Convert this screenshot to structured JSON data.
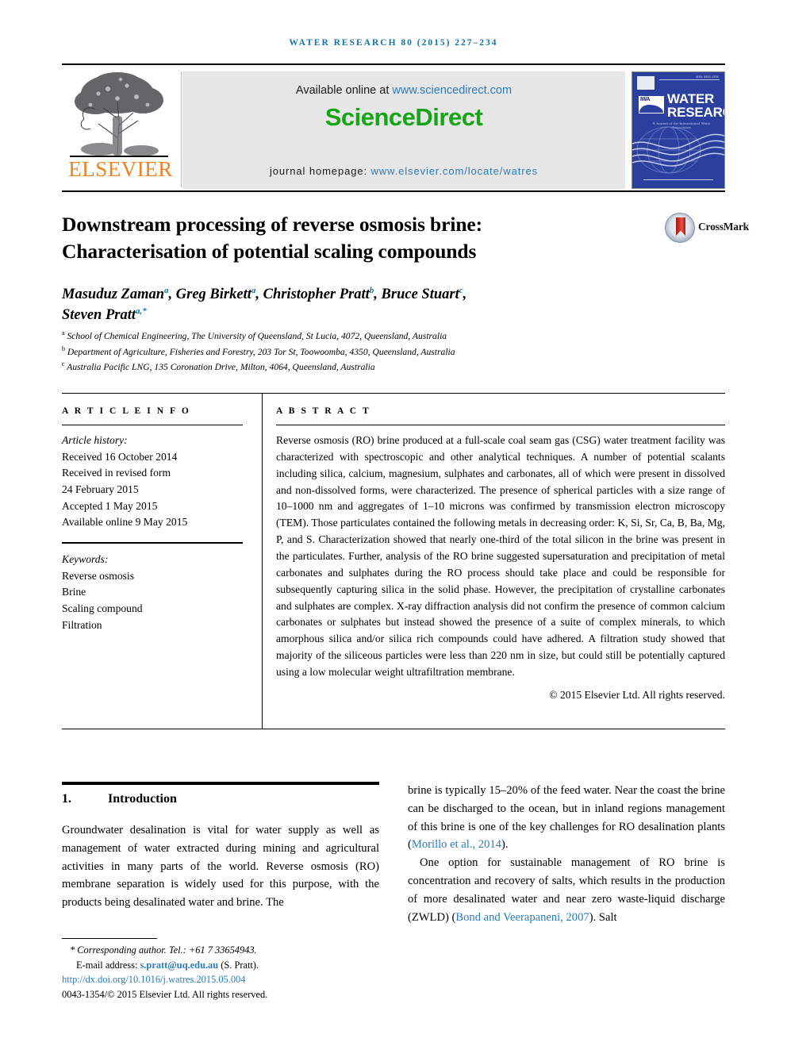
{
  "running_head": "WATER RESEARCH 80 (2015) 227–234",
  "masthead": {
    "publisher_name": "ELSEVIER",
    "available_prefix": "Available online at ",
    "available_url": "www.sciencedirect.com",
    "sciencedirect_logo": "ScienceDirect",
    "homepage_prefix": "journal homepage: ",
    "homepage_url": "www.elsevier.com/locate/watres",
    "cover": {
      "title_line1": "WATER",
      "title_line2": "RESEARCH",
      "org_abbrev": "IWA",
      "subtitle": "A Journal of the International Water Association",
      "issn": "ISSN 0043-1354"
    }
  },
  "article": {
    "title_line1": "Downstream processing of reverse osmosis brine:",
    "title_line2": "Characterisation of potential scaling compounds",
    "crossmark_label": "CrossMark",
    "authors_line1": "Masuduz Zaman",
    "authors_line1_marks": "a",
    "author2": "Greg Birkett",
    "author2_mark": "a",
    "author3": "Christopher Pratt",
    "author3_mark": "b",
    "author4": "Bruce Stuart",
    "author4_mark": "c",
    "author5": "Steven Pratt",
    "author5_mark": "a,*",
    "affiliations": [
      {
        "mark": "a",
        "text": "School of Chemical Engineering, The University of Queensland, St Lucia, 4072, Queensland, Australia"
      },
      {
        "mark": "b",
        "text": "Department of Agriculture, Fisheries and Forestry, 203 Tor St, Toowoomba, 4350, Queensland, Australia"
      },
      {
        "mark": "c",
        "text": "Australia Pacific LNG, 135 Coronation Drive, Milton, 4064, Queensland, Australia"
      }
    ]
  },
  "article_info": {
    "heading": "A R T I C L E  I N F O",
    "history_label": "Article history:",
    "history": [
      "Received 16 October 2014",
      "Received in revised form",
      "24 February 2015",
      "Accepted 1 May 2015",
      "Available online 9 May 2015"
    ],
    "keywords_label": "Keywords:",
    "keywords": [
      "Reverse osmosis",
      "Brine",
      "Scaling compound",
      "Filtration"
    ]
  },
  "abstract": {
    "heading": "A B S T R A C T",
    "body": "Reverse osmosis (RO) brine produced at a full-scale coal seam gas (CSG) water treatment facility was characterized with spectroscopic and other analytical techniques. A number of potential scalants including silica, calcium, magnesium, sulphates and carbonates, all of which were present in dissolved and non-dissolved forms, were characterized. The presence of spherical particles with a size range of 10–1000 nm and aggregates of 1–10 microns was confirmed by transmission electron microscopy (TEM). Those particulates contained the following metals in decreasing order: K, Si, Sr, Ca, B, Ba, Mg, P, and S. Characterization showed that nearly one-third of the total silicon in the brine was present in the particulates. Further, analysis of the RO brine suggested supersaturation and precipitation of metal carbonates and sulphates during the RO process should take place and could be responsible for subsequently capturing silica in the solid phase. However, the precipitation of crystalline carbonates and sulphates are complex. X-ray diffraction analysis did not confirm the presence of common calcium carbonates or sulphates but instead showed the presence of a suite of complex minerals, to which amorphous silica and/or silica rich compounds could have adhered. A filtration study showed that majority of the siliceous particles were less than 220 nm in size, but could still be potentially captured using a low molecular weight ultrafiltration membrane.",
    "copyright": "© 2015 Elsevier Ltd. All rights reserved."
  },
  "introduction": {
    "number": "1.",
    "title": "Introduction",
    "para1": "Groundwater desalination is vital for water supply as well as management of water extracted during mining and agricultural activities in many parts of the world. Reverse osmosis (RO) membrane separation is widely used for this purpose, with the products being desalinated water and brine. The",
    "para2_before": "brine is typically 15–20% of the feed water. Near the coast the brine can be discharged to the ocean, but in inland regions management of this brine is one of the key challenges for RO desalination plants (",
    "para2_cite": "Morillo et al., 2014",
    "para2_after": ").",
    "para3_before": "One option for sustainable management of RO brine is concentration and recovery of salts, which results in the production of more desalinated water and near zero waste-liquid discharge (ZWLD) (",
    "para3_cite": "Bond and Veerapaneni, 2007",
    "para3_after": "). Salt"
  },
  "footnote": {
    "corresponding": "* Corresponding author. Tel.: +61 7 33654943.",
    "email_label": "E-mail address: ",
    "email": "s.pratt@uq.edu.au",
    "email_suffix": " (S. Pratt).",
    "doi": "http://dx.doi.org/10.1016/j.watres.2015.05.004",
    "issn_line": "0043-1354/© 2015 Elsevier Ltd. All rights reserved."
  },
  "colors": {
    "link": "#2b7bb9",
    "running_head": "#1073a8",
    "elsevier_orange": "#f08122",
    "sciencedirect_green": "#16a516",
    "cover_blue": "#2b3f9e"
  }
}
